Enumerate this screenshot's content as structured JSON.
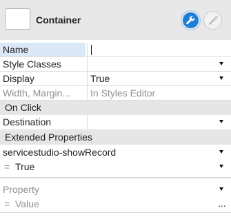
{
  "header": {
    "title": "Container",
    "primary_icon": "wrench-icon",
    "secondary_icon": "wrench-icon",
    "colors": {
      "accent": "#1f7fd8",
      "header_bg": "#e8e8e8"
    }
  },
  "properties": {
    "name": {
      "label": "Name",
      "value": ""
    },
    "style_classes": {
      "label": "Style Classes",
      "value": ""
    },
    "display": {
      "label": "Display",
      "value": "True"
    },
    "width_margin": {
      "label": "Width, Margin...",
      "value": "In Styles Editor"
    }
  },
  "on_click": {
    "section_label": "On Click",
    "destination": {
      "label": "Destination",
      "value": ""
    }
  },
  "extended": {
    "section_label": "Extended Properties",
    "items": [
      {
        "name": "servicestudio-showRecord",
        "eq": "=",
        "value": "True"
      }
    ],
    "new_item": {
      "property_placeholder": "Property",
      "eq": "=",
      "value_placeholder": "Value",
      "more": "..."
    }
  }
}
